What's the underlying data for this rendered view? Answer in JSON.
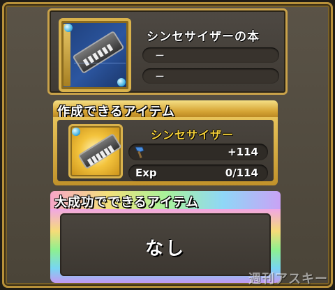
{
  "recipe": {
    "title": "シンセサイザーの本",
    "slot1": "－",
    "slot2": "－",
    "icon": "synthesizer-book-icon"
  },
  "craftable": {
    "header": "作成できるアイテム",
    "item_name": "シンセサイザー",
    "icon": "synthesizer-icon",
    "attack_value": "+114",
    "attack_icon": "hammer-icon",
    "exp_label": "Exp",
    "exp_value": "0/114"
  },
  "great_success": {
    "header": "大成功でできるアイテム",
    "result": "なし"
  },
  "watermark": "週刊アスキー",
  "colors": {
    "gold": "#d9b24c",
    "item_name": "#f7d23a",
    "panel_dark": "#3c3731"
  }
}
